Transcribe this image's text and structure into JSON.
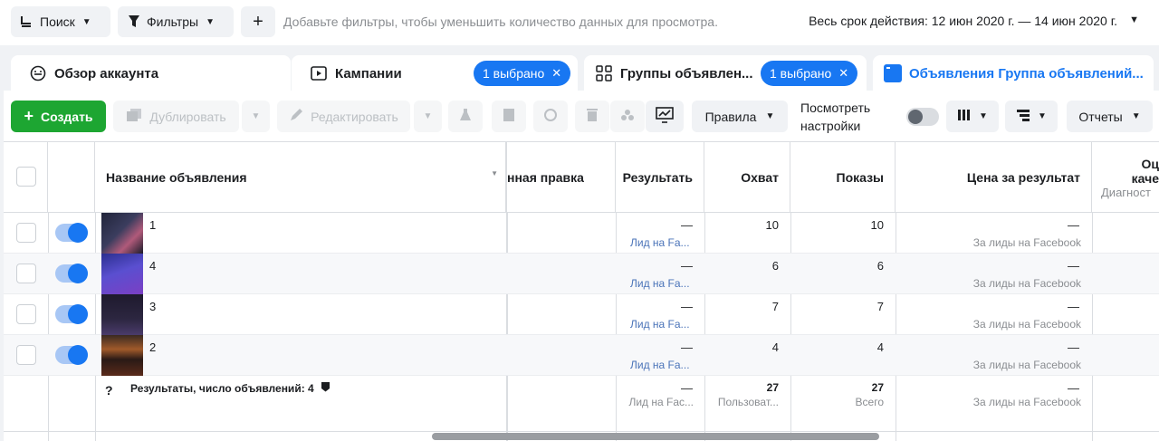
{
  "topbar": {
    "search_label": "Поиск",
    "filters_label": "Фильтры",
    "add_label": "+",
    "hint": "Добавьте фильтры, чтобы уменьшить количество данных для просмотра.",
    "date_range": "Весь срок действия: 12 июн 2020 г. — 14 июн 2020 г."
  },
  "tabs": [
    {
      "label": "Обзор аккаунта",
      "icon": "dashboard-icon"
    },
    {
      "label": "Кампании",
      "icon": "campaign-icon",
      "badge": "1 выбрано"
    },
    {
      "label": "Группы объявлен...",
      "icon": "adsets-grid-icon",
      "badge": "1 выбрано"
    },
    {
      "label": "Объявления Группа объявлений...",
      "icon": "ads-icon",
      "active": true
    }
  ],
  "toolbar": {
    "create_label": "Создать",
    "duplicate_label": "Дублировать",
    "edit_label": "Редактировать",
    "rules_label": "Правила",
    "view_settings_line1": "Посмотреть",
    "view_settings_line2": "настройки",
    "reports_label": "Отчеты"
  },
  "table": {
    "headers": {
      "name": "Название объявления",
      "bulk_edit": "нная правка",
      "result": "Результать",
      "reach": "Охват",
      "impressions": "Показы",
      "cost_per_result": "Цена за результат",
      "quality_partial": "Оц",
      "quality_partial2": "каче",
      "quality_sub": "Диагност"
    },
    "rows": [
      {
        "name": "1",
        "result": "—",
        "result_sub": "Лид на Fa...",
        "reach": "10",
        "impressions": "10",
        "cost": "—",
        "cost_sub": "За лиды на Facebook"
      },
      {
        "name": "4",
        "result": "—",
        "result_sub": "Лид на Fa...",
        "reach": "6",
        "impressions": "6",
        "cost": "—",
        "cost_sub": "За лиды на Facebook"
      },
      {
        "name": "3",
        "result": "—",
        "result_sub": "Лид на Fa...",
        "reach": "7",
        "impressions": "7",
        "cost": "—",
        "cost_sub": "За лиды на Facebook"
      },
      {
        "name": "2",
        "result": "—",
        "result_sub": "Лид на Fa...",
        "reach": "4",
        "impressions": "4",
        "cost": "—",
        "cost_sub": "За лиды на Facebook"
      }
    ],
    "summary": {
      "label": "Результаты, число объявлений: 4",
      "result": "—",
      "result_sub": "Лид на Fac...",
      "reach": "27",
      "reach_sub": "Пользоват...",
      "impressions": "27",
      "impressions_sub": "Всего",
      "cost": "—",
      "cost_sub": "За лиды на Facebook"
    }
  },
  "colors": {
    "accent": "#1877f2",
    "create": "#1da632"
  }
}
